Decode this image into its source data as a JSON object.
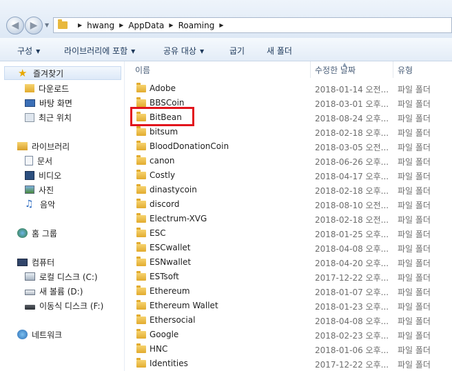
{
  "address": {
    "crumbs": [
      "hwang",
      "AppData",
      "Roaming"
    ]
  },
  "toolbar": {
    "organize": "구성",
    "include_library": "라이브러리에 포함",
    "share": "공유 대상",
    "burn": "굽기",
    "new_folder": "새 폴더"
  },
  "nav": {
    "favorites": "즐겨찾기",
    "downloads": "다운로드",
    "desktop": "바탕 화면",
    "recent": "최근 위치",
    "libraries": "라이브러리",
    "documents": "문서",
    "videos": "비디오",
    "pictures": "사진",
    "music": "음악",
    "homegroup": "홈 그룹",
    "computer": "컴퓨터",
    "drive_c": "로컬 디스크 (C:)",
    "drive_d": "새 볼륨 (D:)",
    "drive_f": "이동식 디스크 (F:)",
    "network": "네트워크"
  },
  "columns": {
    "name": "이름",
    "date": "수정한 날짜",
    "type": "유형"
  },
  "files": [
    {
      "name": "Adobe",
      "date": "2018-01-14 오전...",
      "type": "파일 폴더"
    },
    {
      "name": "BBSCoin",
      "date": "2018-03-01 오후...",
      "type": "파일 폴더"
    },
    {
      "name": "BitBean",
      "date": "2018-08-24 오후...",
      "type": "파일 폴더"
    },
    {
      "name": "bitsum",
      "date": "2018-02-18 오후...",
      "type": "파일 폴더"
    },
    {
      "name": "BloodDonationCoin",
      "date": "2018-03-05 오전...",
      "type": "파일 폴더"
    },
    {
      "name": "canon",
      "date": "2018-06-26 오후...",
      "type": "파일 폴더"
    },
    {
      "name": "Costly",
      "date": "2018-04-17 오후...",
      "type": "파일 폴더"
    },
    {
      "name": "dinastycoin",
      "date": "2018-02-18 오후...",
      "type": "파일 폴더"
    },
    {
      "name": "discord",
      "date": "2018-08-10 오전...",
      "type": "파일 폴더"
    },
    {
      "name": "Electrum-XVG",
      "date": "2018-02-18 오전...",
      "type": "파일 폴더"
    },
    {
      "name": "ESC",
      "date": "2018-01-25 오후...",
      "type": "파일 폴더"
    },
    {
      "name": "ESCwallet",
      "date": "2018-04-08 오후...",
      "type": "파일 폴더"
    },
    {
      "name": "ESNwallet",
      "date": "2018-04-20 오후...",
      "type": "파일 폴더"
    },
    {
      "name": "ESTsoft",
      "date": "2017-12-22 오후...",
      "type": "파일 폴더"
    },
    {
      "name": "Ethereum",
      "date": "2018-01-07 오후...",
      "type": "파일 폴더"
    },
    {
      "name": "Ethereum Wallet",
      "date": "2018-01-23 오후...",
      "type": "파일 폴더"
    },
    {
      "name": "Ethersocial",
      "date": "2018-04-08 오후...",
      "type": "파일 폴더"
    },
    {
      "name": "Google",
      "date": "2018-02-23 오후...",
      "type": "파일 폴더"
    },
    {
      "name": "HNC",
      "date": "2018-01-06 오후...",
      "type": "파일 폴더"
    },
    {
      "name": "Identities",
      "date": "2017-12-22 오후...",
      "type": "파일 폴더"
    }
  ]
}
